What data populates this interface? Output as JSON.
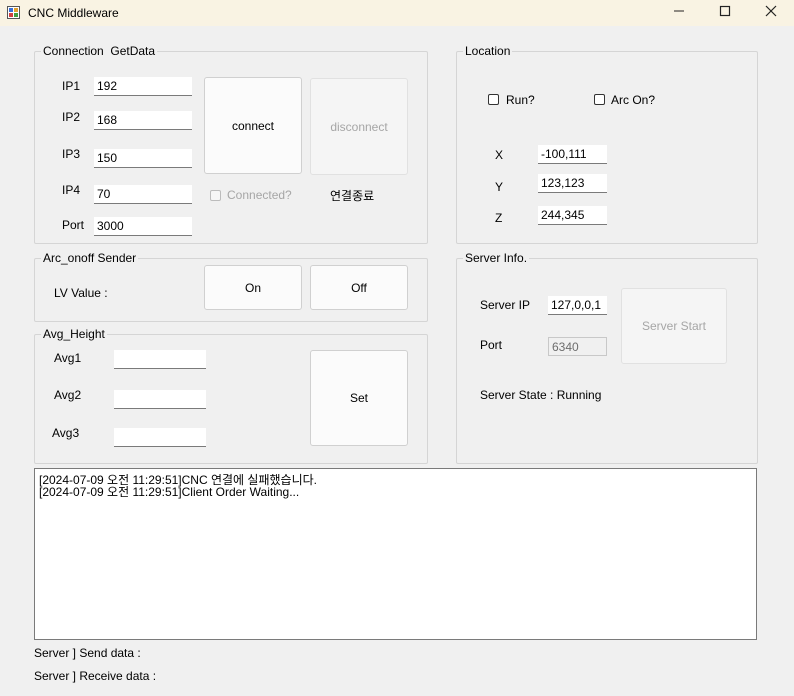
{
  "window": {
    "title": "CNC Middleware",
    "minimize_icon": "minimize-icon",
    "maximize_icon": "maximize-icon",
    "close_icon": "close-icon"
  },
  "connection": {
    "legend": "Connection  GetData",
    "ip1_label": "IP1",
    "ip1_value": "192",
    "ip2_label": "IP2",
    "ip2_value": "168",
    "ip3_label": "IP3",
    "ip3_value": "150",
    "ip4_label": "IP4",
    "ip4_value": "70",
    "port_label": "Port",
    "port_value": "3000",
    "connect_label": "connect",
    "disconnect_label": "disconnect",
    "connected_label": "Connected?",
    "connected_checked": false,
    "end_label": "연결종료"
  },
  "location": {
    "legend": "Location",
    "run_label": "Run?",
    "run_checked": false,
    "arc_label": "Arc On?",
    "arc_checked": false,
    "x_label": "X",
    "x_value": "-100,111",
    "y_label": "Y",
    "y_value": "123,123",
    "z_label": "Z",
    "z_value": "244,345"
  },
  "arc_sender": {
    "legend": "Arc_onoff Sender",
    "lv_label": "LV Value :",
    "on_label": "On",
    "off_label": "Off"
  },
  "avg_height": {
    "legend": "Avg_Height",
    "avg1_label": "Avg1",
    "avg1_value": "",
    "avg2_label": "Avg2",
    "avg2_value": "",
    "avg3_label": "Avg3",
    "avg3_value": "",
    "set_label": "Set"
  },
  "server_info": {
    "legend": "Server Info.",
    "ip_label": "Server IP",
    "ip_value": "127,0,0,1",
    "port_label": "Port",
    "port_value": "6340",
    "start_label": "Server Start",
    "state_label": "Server State : Running"
  },
  "log": {
    "lines": [
      "[2024-07-09 오전 11:29:51]CNC 연결에 실패했습니다.",
      "[2024-07-09 오전 11:29:51]Client Order Waiting..."
    ]
  },
  "footer": {
    "send_label": "Server ] Send data :",
    "receive_label": "Server ] Receive data :"
  }
}
